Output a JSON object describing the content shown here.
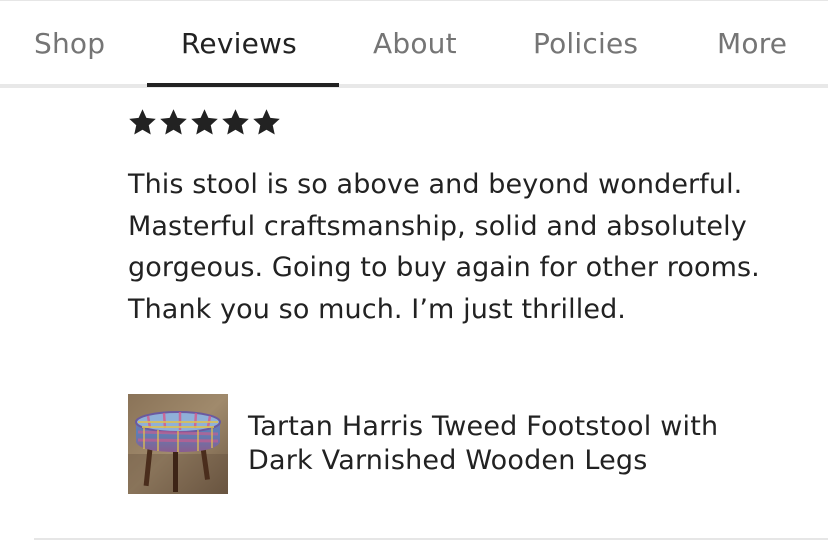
{
  "tabs": [
    {
      "label": "Shop",
      "active": false
    },
    {
      "label": "Reviews",
      "active": true
    },
    {
      "label": "About",
      "active": false
    },
    {
      "label": "Policies",
      "active": false
    },
    {
      "label": "More",
      "active": false
    }
  ],
  "review": {
    "rating": 5,
    "max_rating": 5,
    "text": "This stool is so above and beyond wonderful. Masterful craftsmanship, solid and absolutely gorgeous. Going to buy again for other rooms. Thank you so much. I’m just thrilled.",
    "product": {
      "title": "Tartan Harris Tweed Footstool with Dark Varnished Wooden Legs",
      "thumbnail_icon": "footstool-thumbnail"
    }
  },
  "colors": {
    "text_primary": "#222222",
    "text_muted": "#757575",
    "divider": "#e8e8e8",
    "star": "#222222"
  }
}
